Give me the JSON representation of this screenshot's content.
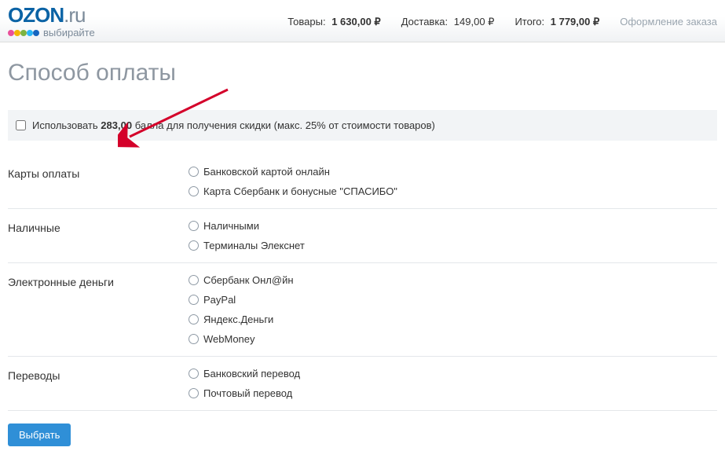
{
  "logo": {
    "name_blue": "OZON",
    "name_gray": ".ru",
    "subtitle": "выбирайте",
    "dot_colors": [
      "#e94f9a",
      "#f4b400",
      "#7cb342",
      "#29b6f6",
      "#1565c0"
    ]
  },
  "summary": {
    "goods_label": "Товары:",
    "goods_value": "1 630,00 ₽",
    "delivery_label": "Доставка:",
    "delivery_value": "149,00 ₽",
    "total_label": "Итого:",
    "total_value": "1 779,00 ₽",
    "checkout_step": "Оформление заказа"
  },
  "page_title": "Способ оплаты",
  "points": {
    "prefix": "Использовать",
    "amount": "283,00",
    "suffix": "балла для получения скидки (макс. 25% от стоимости товаров)"
  },
  "sections": [
    {
      "label": "Карты оплаты",
      "options": [
        "Банковской картой онлайн",
        "Карта Сбербанк и бонусные \"СПАСИБО\""
      ]
    },
    {
      "label": "Наличные",
      "options": [
        "Наличными",
        "Терминалы Элекснет"
      ]
    },
    {
      "label": "Электронные деньги",
      "options": [
        "Сбербанк Онл@йн",
        "PayPal",
        "Яндекс.Деньги",
        "WebMoney"
      ]
    },
    {
      "label": "Переводы",
      "options": [
        "Банковский перевод",
        "Почтовый перевод"
      ]
    }
  ],
  "submit_label": "Выбрать"
}
